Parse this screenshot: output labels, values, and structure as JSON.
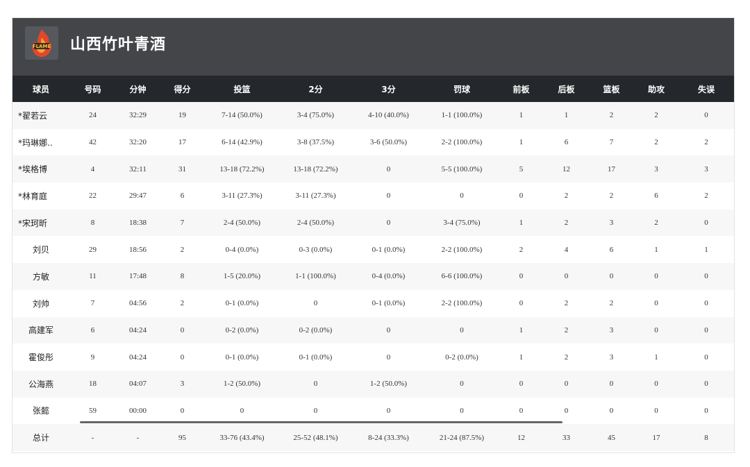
{
  "team": {
    "name": "山西竹叶青酒",
    "logo_icon": "flame-team-logo-icon"
  },
  "columns": [
    "球员",
    "号码",
    "分钟",
    "得分",
    "投篮",
    "2分",
    "3分",
    "罚球",
    "前板",
    "后板",
    "篮板",
    "助攻",
    "失误"
  ],
  "rows": [
    {
      "name": "*翟若云",
      "starter": true,
      "num": "24",
      "min": "32:29",
      "pts": "19",
      "fg": "7-14 (50.0%)",
      "p2": "3-4 (75.0%)",
      "p3": "4-10 (40.0%)",
      "ft": "1-1 (100.0%)",
      "oreb": "1",
      "dreb": "1",
      "reb": "2",
      "ast": "2",
      "tov": "0"
    },
    {
      "name": "*玛琳娜..",
      "starter": true,
      "num": "42",
      "min": "32:20",
      "pts": "17",
      "fg": "6-14 (42.9%)",
      "p2": "3-8 (37.5%)",
      "p3": "3-6 (50.0%)",
      "ft": "2-2 (100.0%)",
      "oreb": "1",
      "dreb": "6",
      "reb": "7",
      "ast": "2",
      "tov": "2"
    },
    {
      "name": "*埃格博",
      "starter": true,
      "num": "4",
      "min": "32:11",
      "pts": "31",
      "fg": "13-18 (72.2%)",
      "p2": "13-18 (72.2%)",
      "p3": "0",
      "ft": "5-5 (100.0%)",
      "oreb": "5",
      "dreb": "12",
      "reb": "17",
      "ast": "3",
      "tov": "3"
    },
    {
      "name": "*林育庭",
      "starter": true,
      "num": "22",
      "min": "29:47",
      "pts": "6",
      "fg": "3-11 (27.3%)",
      "p2": "3-11 (27.3%)",
      "p3": "0",
      "ft": "0",
      "oreb": "0",
      "dreb": "2",
      "reb": "2",
      "ast": "6",
      "tov": "2"
    },
    {
      "name": "*宋珂昕",
      "starter": true,
      "num": "8",
      "min": "18:38",
      "pts": "7",
      "fg": "2-4 (50.0%)",
      "p2": "2-4 (50.0%)",
      "p3": "0",
      "ft": "3-4 (75.0%)",
      "oreb": "1",
      "dreb": "2",
      "reb": "3",
      "ast": "2",
      "tov": "0"
    },
    {
      "name": "刘贝",
      "starter": false,
      "num": "29",
      "min": "18:56",
      "pts": "2",
      "fg": "0-4 (0.0%)",
      "p2": "0-3 (0.0%)",
      "p3": "0-1 (0.0%)",
      "ft": "2-2 (100.0%)",
      "oreb": "2",
      "dreb": "4",
      "reb": "6",
      "ast": "1",
      "tov": "1"
    },
    {
      "name": "方敏",
      "starter": false,
      "num": "11",
      "min": "17:48",
      "pts": "8",
      "fg": "1-5 (20.0%)",
      "p2": "1-1 (100.0%)",
      "p3": "0-4 (0.0%)",
      "ft": "6-6 (100.0%)",
      "oreb": "0",
      "dreb": "0",
      "reb": "0",
      "ast": "0",
      "tov": "0"
    },
    {
      "name": "刘帅",
      "starter": false,
      "num": "7",
      "min": "04:56",
      "pts": "2",
      "fg": "0-1 (0.0%)",
      "p2": "0",
      "p3": "0-1 (0.0%)",
      "ft": "2-2 (100.0%)",
      "oreb": "0",
      "dreb": "2",
      "reb": "2",
      "ast": "0",
      "tov": "0"
    },
    {
      "name": "高建军",
      "starter": false,
      "num": "6",
      "min": "04:24",
      "pts": "0",
      "fg": "0-2 (0.0%)",
      "p2": "0-2 (0.0%)",
      "p3": "0",
      "ft": "0",
      "oreb": "1",
      "dreb": "2",
      "reb": "3",
      "ast": "0",
      "tov": "0"
    },
    {
      "name": "霍俊彤",
      "starter": false,
      "num": "9",
      "min": "04:24",
      "pts": "0",
      "fg": "0-1 (0.0%)",
      "p2": "0-1 (0.0%)",
      "p3": "0",
      "ft": "0-2 (0.0%)",
      "oreb": "1",
      "dreb": "2",
      "reb": "3",
      "ast": "1",
      "tov": "0"
    },
    {
      "name": "公海燕",
      "starter": false,
      "num": "18",
      "min": "04:07",
      "pts": "3",
      "fg": "1-2 (50.0%)",
      "p2": "0",
      "p3": "1-2 (50.0%)",
      "ft": "0",
      "oreb": "0",
      "dreb": "0",
      "reb": "0",
      "ast": "0",
      "tov": "0"
    },
    {
      "name": "张懿",
      "starter": false,
      "num": "59",
      "min": "00:00",
      "pts": "0",
      "fg": "0",
      "p2": "0",
      "p3": "0",
      "ft": "0",
      "oreb": "0",
      "dreb": "0",
      "reb": "0",
      "ast": "0",
      "tov": "0"
    }
  ],
  "total": {
    "name": "总计",
    "num": "-",
    "min": "-",
    "pts": "95",
    "fg": "33-76 (43.4%)",
    "p2": "25-52 (48.1%)",
    "p3": "8-24 (33.3%)",
    "ft": "21-24 (87.5%)",
    "oreb": "12",
    "dreb": "33",
    "reb": "45",
    "ast": "17",
    "tov": "8"
  },
  "colors": {
    "header_bg": "#434548",
    "table_header_bg": "#24272b",
    "row_alt": "#f7f7f8"
  }
}
